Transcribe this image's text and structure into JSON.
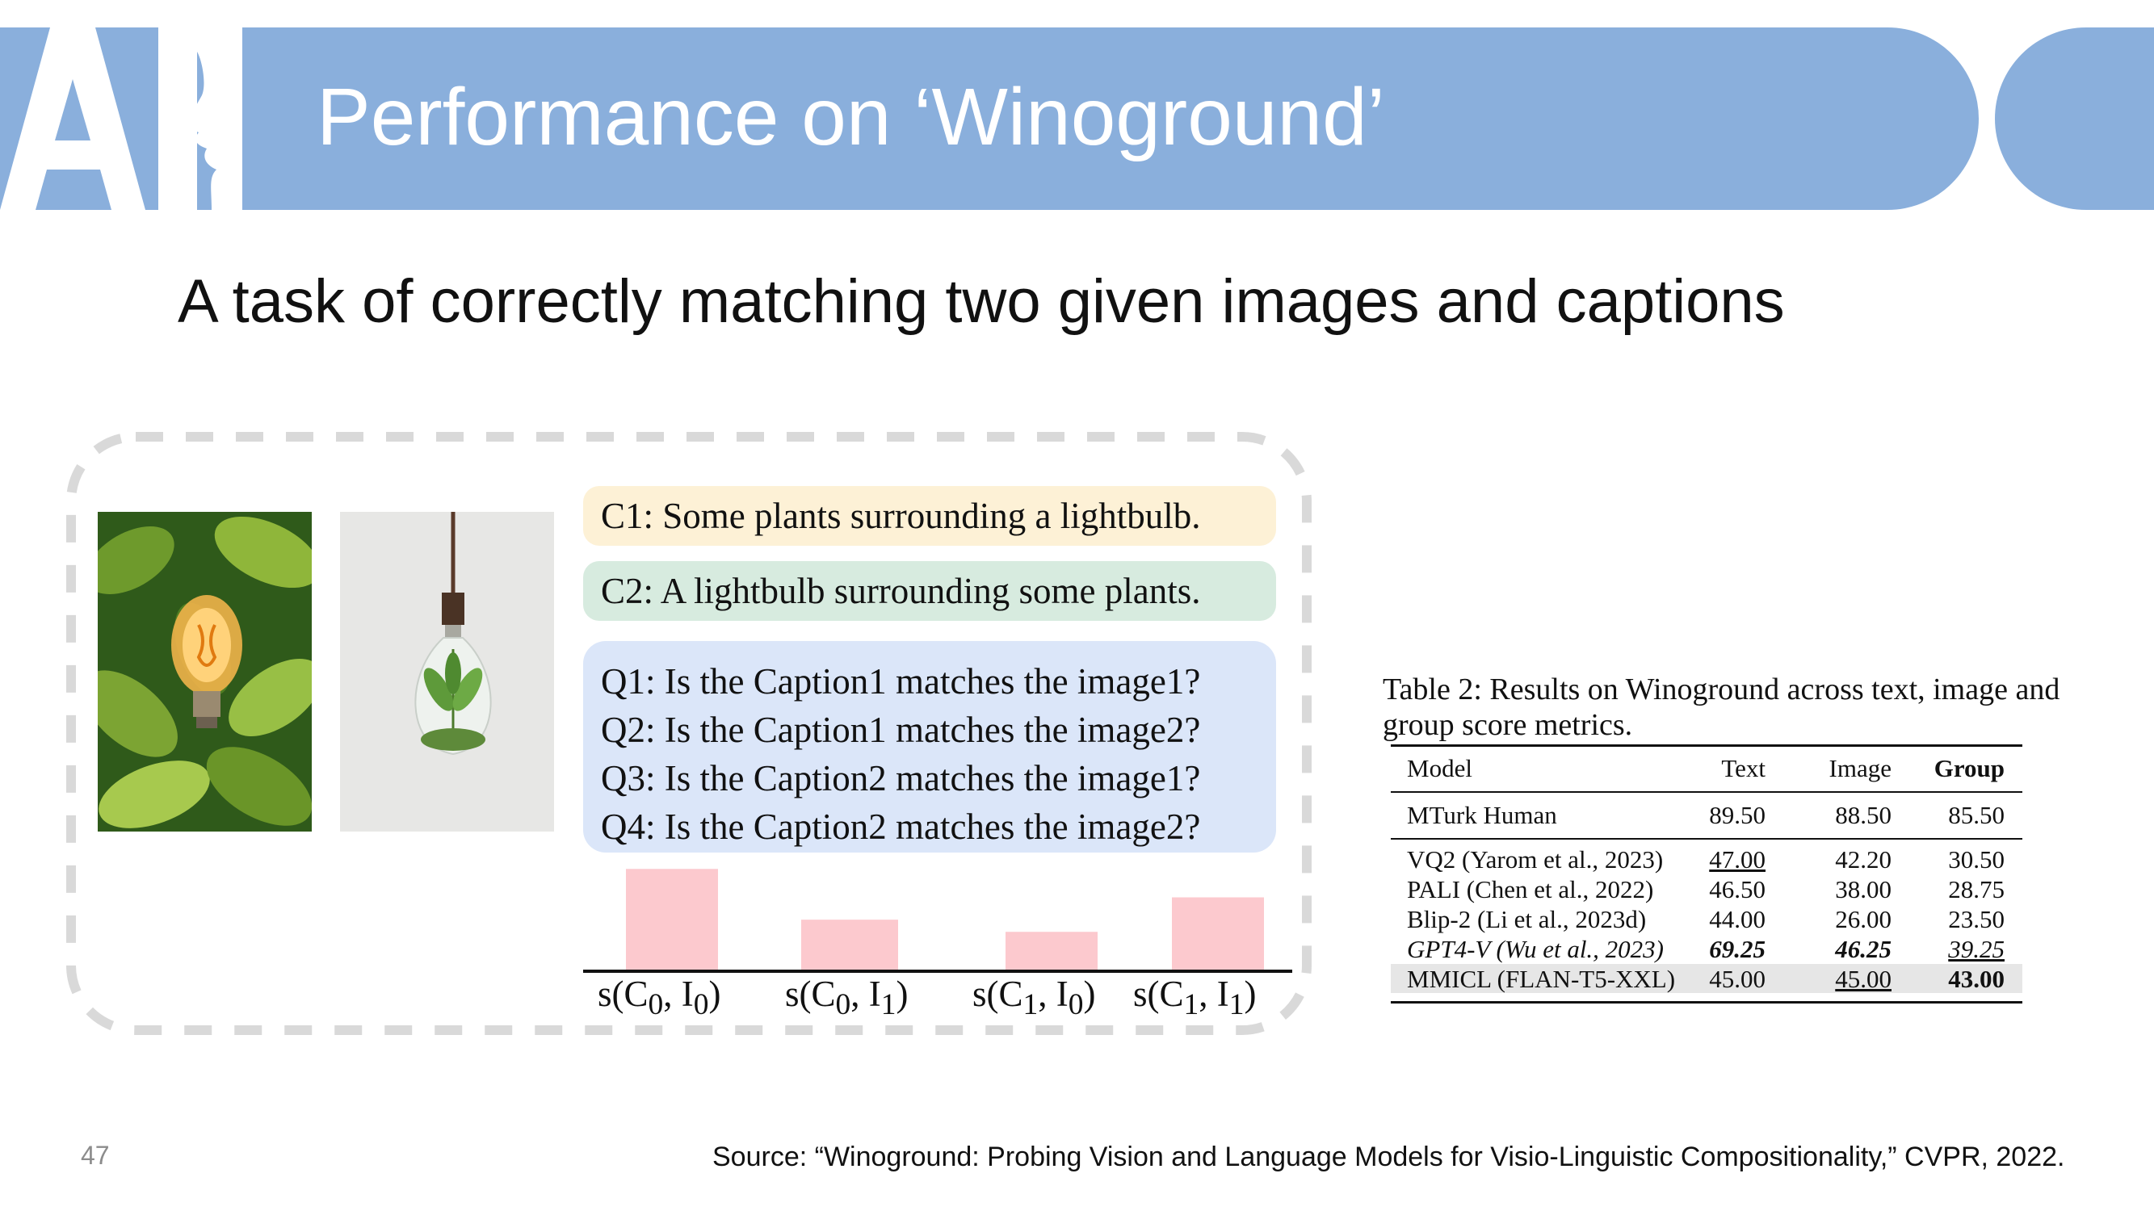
{
  "slide": {
    "logo_text": "AI",
    "title": "Performance on ‘Winoground’",
    "subtitle": "A task of correctly matching two given images and captions",
    "page_number": "47",
    "source": "Source: “Winoground: Probing Vision and Language Models for Visio-Linguistic Compositionality,” CVPR, 2022."
  },
  "colors": {
    "banner": "#8aafdc",
    "caption1_bg": "#fdf1d6",
    "caption2_bg": "#d7ebdf",
    "questions_bg": "#dbe6f9",
    "bar": "#fcc9ce"
  },
  "figure": {
    "captions": [
      "C1:  Some plants surrounding a lightbulb.",
      "C2:  A lightbulb surrounding some plants."
    ],
    "questions": [
      "Q1: Is the Caption1 matches the image1?",
      "Q2: Is the Caption1 matches the image2?",
      "Q3: Is the Caption2 matches the image1?",
      "Q4: Is the Caption2 matches the image2?"
    ]
  },
  "chart_data": {
    "type": "bar",
    "categories": [
      "s(C₀, I₀)",
      "s(C₀, I₁)",
      "s(C₁, I₀)",
      "s(C₁, I₁)"
    ],
    "values": [
      1.0,
      0.5,
      0.38,
      0.72
    ],
    "title": "",
    "xlabel": "",
    "ylabel": "",
    "ylim": [
      0,
      1.05
    ],
    "grid": false,
    "legend": "none"
  },
  "table": {
    "caption": "Table 2: Results on Winoground across text, image and group score metrics.",
    "headers": [
      "Model",
      "Text",
      "Image",
      "Group"
    ],
    "human_row": [
      "MTurk Human",
      "89.50",
      "88.50",
      "85.50"
    ],
    "rows": [
      [
        "VQ2 (Yarom et al., 2023)",
        "47.00",
        "42.20",
        "30.50"
      ],
      [
        "PALI (Chen et al., 2022)",
        "46.50",
        "38.00",
        "28.75"
      ],
      [
        "Blip-2 (Li et al., 2023d)",
        "44.00",
        "26.00",
        "23.50"
      ],
      [
        "GPT4-V (Wu et al., 2023)",
        "69.25",
        "46.25",
        "39.25"
      ],
      [
        "MMICL (FLAN-T5-XXL)",
        "45.00",
        "45.00",
        "43.00"
      ]
    ]
  }
}
